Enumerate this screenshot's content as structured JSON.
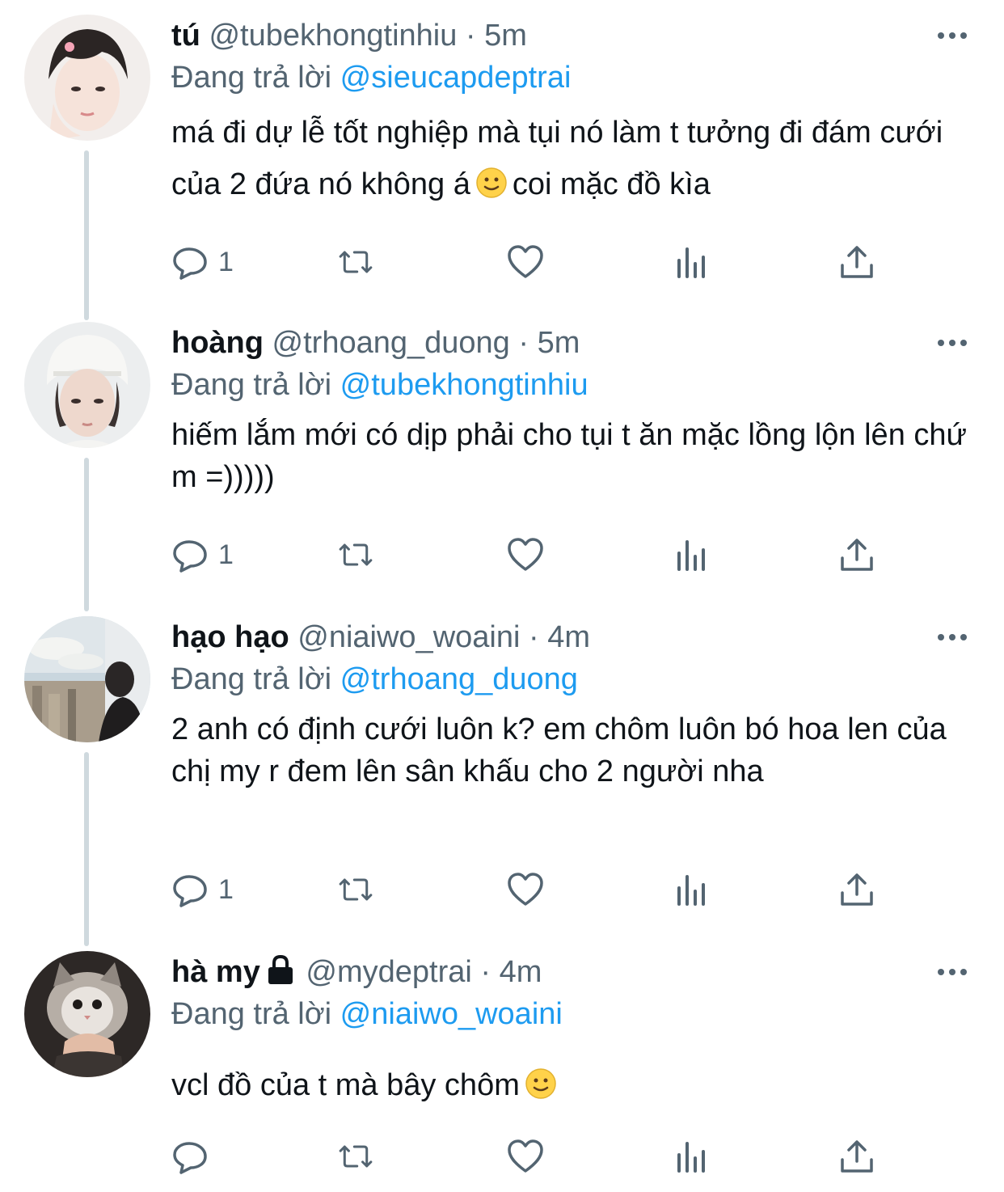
{
  "thread": {
    "tweets": [
      {
        "display_name": "tú",
        "handle": "@tubekhongtinhiu",
        "dot": "·",
        "time": "5m",
        "replying_label": "Đang trả lời",
        "replying_to": "@sieucapdeptrai",
        "text_part1": "má đi dự lễ tốt nghiệp mà tụi nó làm t tưởng đi đám cưới của 2 đứa nó không á",
        "text_part2": "coi mặc đồ kìa",
        "reply_count": "1",
        "protected": false
      },
      {
        "display_name": "hoàng",
        "handle": "@trhoang_duong",
        "dot": "·",
        "time": "5m",
        "replying_label": "Đang trả lời",
        "replying_to": "@tubekhongtinhiu",
        "text": "hiếm lắm mới có dịp phải cho tụi t ăn mặc lồng lộn lên chứ m =)))))",
        "reply_count": "1",
        "protected": false
      },
      {
        "display_name": "hạo hạo",
        "handle": "@niaiwo_woaini",
        "dot": "·",
        "time": "4m",
        "replying_label": "Đang trả lời",
        "replying_to": "@trhoang_duong",
        "text": "2 anh có định cưới luôn k? em chôm luôn bó hoa len của chị my r đem lên sân khấu cho 2 người nha",
        "reply_count": "1",
        "protected": false
      },
      {
        "display_name": "hà my",
        "handle": "@mydeptrai",
        "dot": "·",
        "time": "4m",
        "replying_label": "Đang trả lời",
        "replying_to": "@niaiwo_woaini",
        "text": "vcl đồ của t mà bây chôm",
        "reply_count": "",
        "protected": true
      }
    ]
  },
  "icons": {
    "reply": "reply-bubble-icon",
    "retweet": "retweet-icon",
    "like": "heart-icon",
    "stats": "analytics-icon",
    "share": "share-icon",
    "more": "more-dots-icon",
    "lock": "lock-icon",
    "emoji": "slightly-smiling-face-emoji"
  },
  "colors": {
    "text": "#0f1419",
    "secondary": "#536471",
    "link": "#1d9bf0",
    "thread_line": "#cfd9de"
  }
}
